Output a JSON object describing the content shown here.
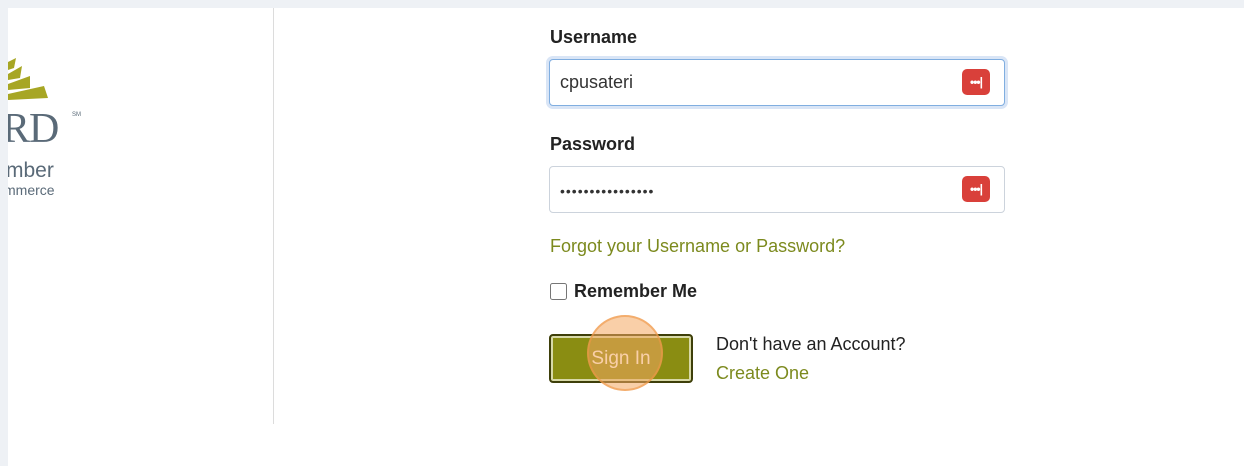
{
  "logo": {
    "text_large": "RD",
    "text_sm": "SM",
    "line1": "mber",
    "line2": "mmerce",
    "colors": {
      "chevron": "#a7a624",
      "text": "#5a6a78"
    }
  },
  "login": {
    "username_label": "Username",
    "username_value": "cpusateri",
    "password_label": "Password",
    "password_value": "••••••••••••••••",
    "password_manager_icon": "password-manager-icon",
    "forgot_link": "Forgot your Username or Password?",
    "remember_label": "Remember Me",
    "remember_checked": false,
    "signin_label": "Sign In",
    "no_account_text": "Don't have an Account?",
    "create_link": "Create One"
  },
  "colors": {
    "accent": "#8a8d12",
    "link": "#7c8a1e",
    "pm_icon": "#d9403a",
    "focus": "#80aee0"
  }
}
